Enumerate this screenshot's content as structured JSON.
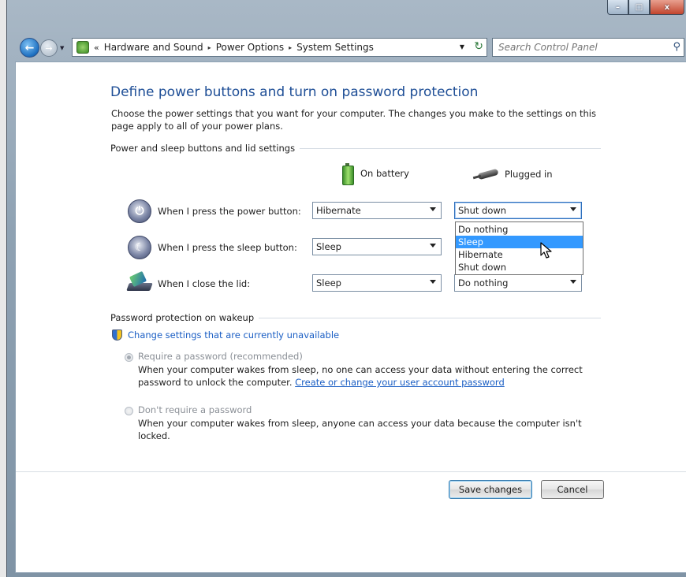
{
  "window": {
    "caption_buttons": {
      "minimize": "–",
      "maximize": "□",
      "close": "x"
    }
  },
  "nav": {
    "back_icon": "back-arrow-icon",
    "forward_icon": "forward-arrow-icon",
    "breadcrumb_prefix": "«",
    "breadcrumb": [
      "Hardware and Sound",
      "Power Options",
      "System Settings"
    ],
    "breadcrumb_separator": "▸",
    "search_placeholder": "Search Control Panel"
  },
  "page": {
    "title": "Define power buttons and turn on password protection",
    "description": "Choose the power settings that you want for your computer. The changes you make to the settings on this page apply to all of your power plans."
  },
  "buttons_section": {
    "title": "Power and sleep buttons and lid settings",
    "col_battery": "On battery",
    "col_plugged": "Plugged in",
    "rows": [
      {
        "label": "When I press the power button:",
        "battery": "Hibernate",
        "plugged": "Shut down"
      },
      {
        "label": "When I press the sleep button:",
        "battery": "Sleep",
        "plugged": ""
      },
      {
        "label": "When I close the lid:",
        "battery": "Sleep",
        "plugged": "Do nothing"
      }
    ],
    "open_dropdown": {
      "options": [
        "Do nothing",
        "Sleep",
        "Hibernate",
        "Shut down"
      ],
      "highlighted": "Sleep"
    }
  },
  "password_section": {
    "title": "Password protection on wakeup",
    "change_link": "Change settings that are currently unavailable",
    "option1_label": "Require a password (recommended)",
    "option1_desc": "When your computer wakes from sleep, no one can access your data without entering the correct password to unlock the computer.",
    "option1_link": "Create or change your user account password",
    "option2_label": "Don't require a password",
    "option2_desc": "When your computer wakes from sleep, anyone can access your data because the computer isn't locked."
  },
  "footer": {
    "save_label": "Save changes",
    "cancel_label": "Cancel"
  },
  "colors": {
    "title_blue": "#1e4e96",
    "link_blue": "#1a5ec4",
    "highlight": "#3399ff"
  }
}
